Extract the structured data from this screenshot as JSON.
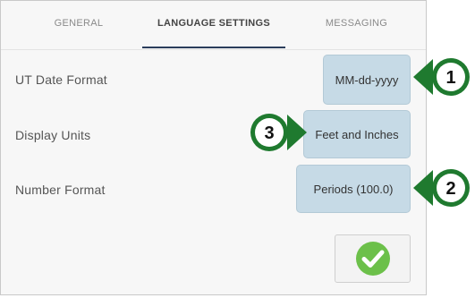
{
  "tabs": [
    {
      "label": "GENERAL",
      "active": false
    },
    {
      "label": "LANGUAGE SETTINGS",
      "active": true
    },
    {
      "label": "MESSAGING",
      "active": false
    }
  ],
  "settings": {
    "date_format": {
      "label": "UT Date Format",
      "value": "MM-dd-yyyy"
    },
    "display_units": {
      "label": "Display Units",
      "value": "Feet and Inches"
    },
    "number_format": {
      "label": "Number Format",
      "value": "Periods (100.0)"
    }
  },
  "callouts": [
    "1",
    "3",
    "2"
  ],
  "colors": {
    "accent_underline": "#2b3e5c",
    "button_fill": "#c6dae6",
    "callout_green": "#1f7a2f",
    "confirm_green": "#6cc04a"
  }
}
